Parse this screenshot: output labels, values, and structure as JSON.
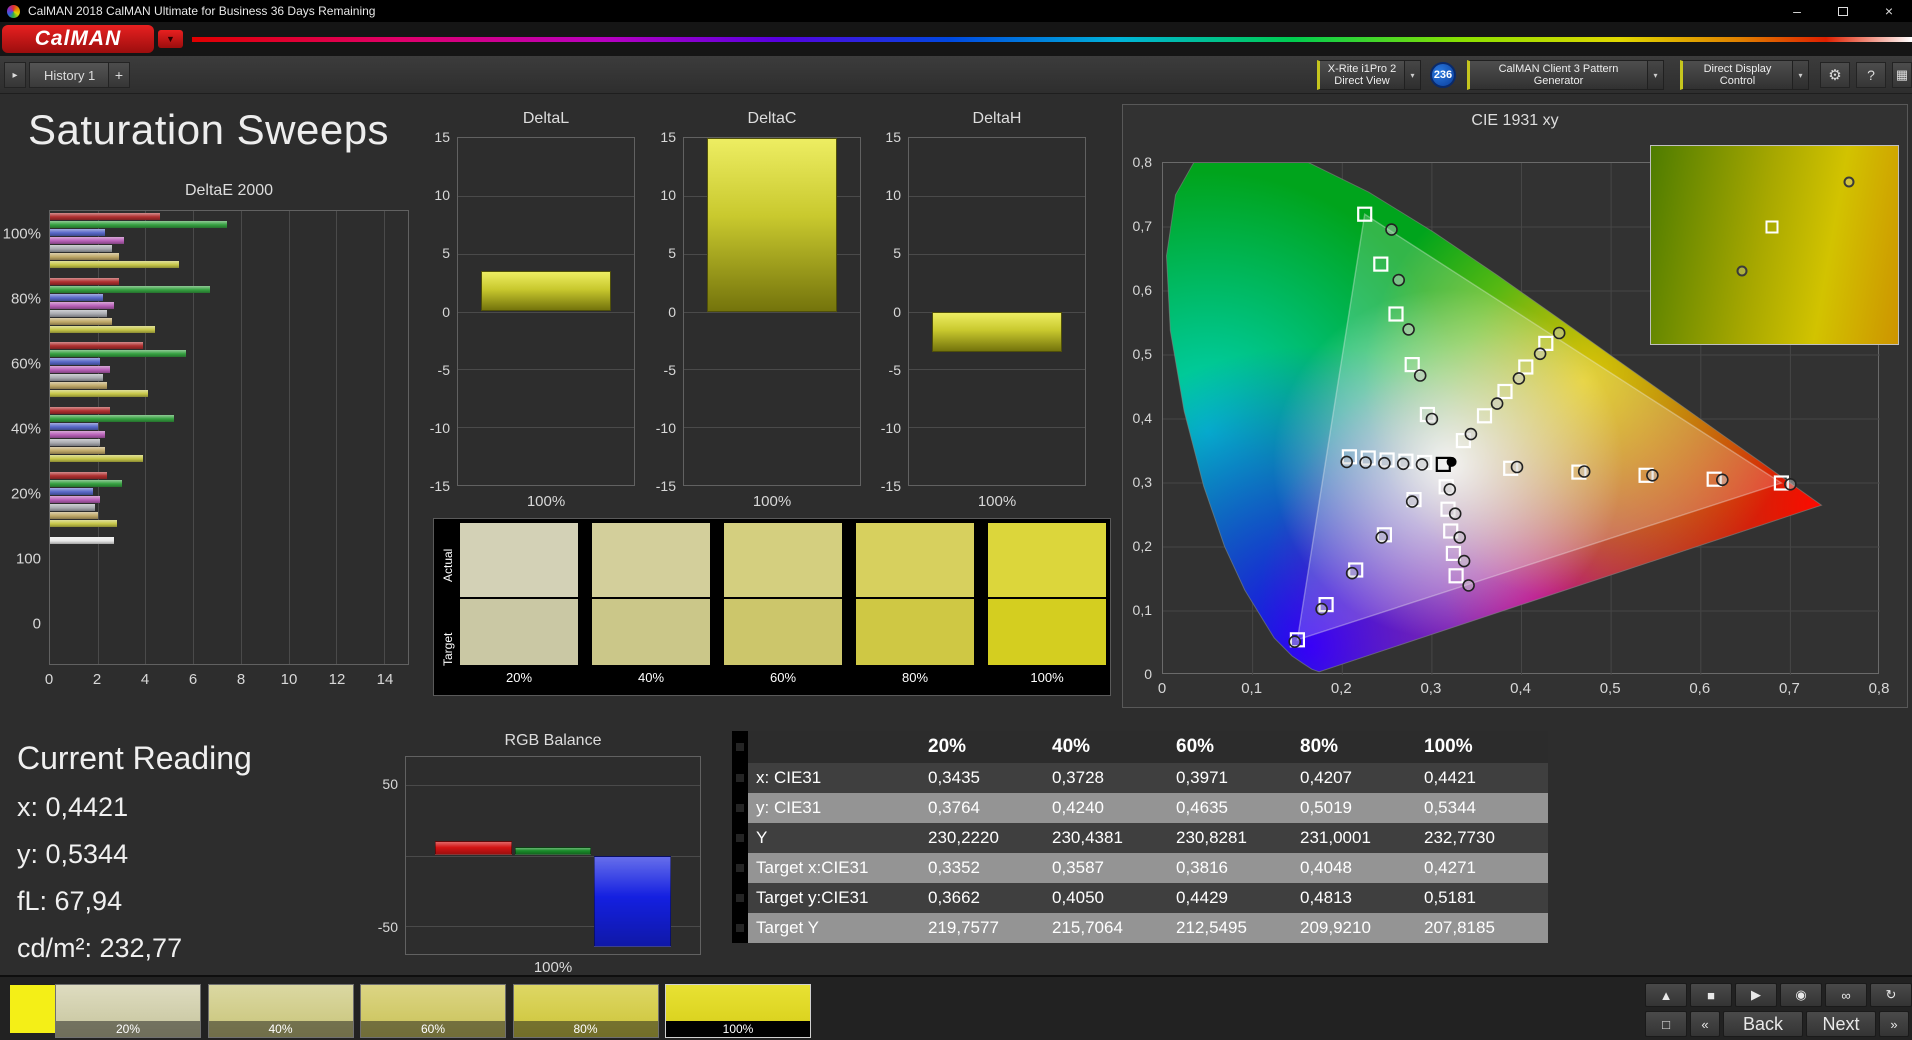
{
  "titlebar": {
    "title": "CalMAN 2018 CalMAN Ultimate for Business 36 Days Remaining",
    "min_glyph": "–",
    "close_glyph": "×"
  },
  "brand": {
    "logo": "CalMAN",
    "dd_glyph": "▼"
  },
  "toolbar": {
    "scroll_glyph": "▸",
    "history_tab": "History 1",
    "add_tab": "+",
    "meter_line1": "X-Rite i1Pro 2",
    "meter_line2": "Direct View",
    "badge": "236",
    "pattern_generator": "CalMAN Client 3 Pattern Generator",
    "display_control": "Direct Display Control",
    "chevron_glyph": "▾",
    "gear_glyph": "⚙",
    "help_glyph": "?",
    "layout_glyph": "▦"
  },
  "page_title": "Saturation Sweeps",
  "current_reading": {
    "title": "Current Reading",
    "lines": [
      "x: 0,4421",
      "y: 0,5344",
      "fL: 67,94",
      "cd/m²: 232,77"
    ]
  },
  "swatch_panel": {
    "row_labels": [
      "Actual",
      "Target"
    ],
    "columns": [
      {
        "label": "20%",
        "actual": "#d3d1b6",
        "target": "#cac8a4"
      },
      {
        "label": "40%",
        "actual": "#d3cf9b",
        "target": "#cbc789"
      },
      {
        "label": "60%",
        "actual": "#d4cf7f",
        "target": "#ccc66b"
      },
      {
        "label": "80%",
        "actual": "#d7d05e",
        "target": "#cfc844"
      },
      {
        "label": "100%",
        "actual": "#dcd63b",
        "target": "#d4ce20"
      }
    ]
  },
  "table": {
    "headers": [
      "",
      "20%",
      "40%",
      "60%",
      "80%",
      "100%"
    ],
    "rows": [
      {
        "label": "x: CIE31",
        "values": [
          "0,3435",
          "0,3728",
          "0,3971",
          "0,4207",
          "0,4421"
        ]
      },
      {
        "label": "y: CIE31",
        "values": [
          "0,3764",
          "0,4240",
          "0,4635",
          "0,5019",
          "0,5344"
        ]
      },
      {
        "label": "Y",
        "values": [
          "230,2220",
          "230,4381",
          "230,8281",
          "231,0001",
          "232,7730"
        ]
      },
      {
        "label": "Target x:CIE31",
        "values": [
          "0,3352",
          "0,3587",
          "0,3816",
          "0,4048",
          "0,4271"
        ]
      },
      {
        "label": "Target y:CIE31",
        "values": [
          "0,3662",
          "0,4050",
          "0,4429",
          "0,4813",
          "0,5181"
        ]
      },
      {
        "label": "Target Y",
        "values": [
          "219,7577",
          "215,7064",
          "212,5495",
          "209,9210",
          "207,8185"
        ]
      }
    ]
  },
  "bottombar": {
    "swatches": [
      {
        "label": "20%",
        "top": "#dedcc0",
        "bottom": "#c6c49c",
        "selected": false
      },
      {
        "label": "40%",
        "top": "#dbd8a2",
        "bottom": "#c8c478",
        "selected": false
      },
      {
        "label": "60%",
        "top": "#dcd584",
        "bottom": "#c9c257",
        "selected": false
      },
      {
        "label": "80%",
        "top": "#ded764",
        "bottom": "#ccc438",
        "selected": false
      },
      {
        "label": "100%",
        "top": "#e8e133",
        "bottom": "#d6ce18",
        "selected": true
      }
    ],
    "transport": [
      {
        "name": "eject-icon",
        "glyph": "▲"
      },
      {
        "name": "stop-icon",
        "glyph": "■"
      },
      {
        "name": "play-icon",
        "glyph": "▶"
      },
      {
        "name": "camera-icon",
        "glyph": "◉"
      },
      {
        "name": "infinity-icon",
        "glyph": "∞"
      },
      {
        "name": "loop-icon",
        "glyph": "↻"
      }
    ],
    "nav": {
      "pattern_glyph": "□",
      "prev_glyph": "«",
      "back": "Back",
      "next": "Next",
      "fwd_glyph": "»"
    }
  },
  "chart_data": [
    {
      "id": "deltae2000",
      "type": "bar",
      "orientation": "horizontal",
      "title": "DeltaE 2000",
      "xlim": [
        0,
        15
      ],
      "xticks": [
        0,
        2,
        4,
        6,
        8,
        10,
        12,
        14
      ],
      "groups": [
        {
          "label": "100%",
          "bars": [
            {
              "color": "#b03030",
              "value": 4.6
            },
            {
              "color": "#35a040",
              "value": 7.4
            },
            {
              "color": "#5868c8",
              "value": 2.3
            },
            {
              "color": "#b860b8",
              "value": 3.1
            },
            {
              "color": "#a8aab0",
              "value": 2.6
            },
            {
              "color": "#c0a868",
              "value": 2.9
            },
            {
              "color": "#c6c648",
              "value": 5.4
            }
          ]
        },
        {
          "label": "80%",
          "bars": [
            {
              "color": "#b03030",
              "value": 2.9
            },
            {
              "color": "#35a040",
              "value": 6.7
            },
            {
              "color": "#5868c8",
              "value": 2.2
            },
            {
              "color": "#b860b8",
              "value": 2.7
            },
            {
              "color": "#a8aab0",
              "value": 2.4
            },
            {
              "color": "#c0a868",
              "value": 2.6
            },
            {
              "color": "#c6c648",
              "value": 4.4
            }
          ]
        },
        {
          "label": "60%",
          "bars": [
            {
              "color": "#b03030",
              "value": 3.9
            },
            {
              "color": "#35a040",
              "value": 5.7
            },
            {
              "color": "#5868c8",
              "value": 2.1
            },
            {
              "color": "#b860b8",
              "value": 2.5
            },
            {
              "color": "#a8aab0",
              "value": 2.2
            },
            {
              "color": "#c0a868",
              "value": 2.4
            },
            {
              "color": "#c6c648",
              "value": 4.1
            }
          ]
        },
        {
          "label": "40%",
          "bars": [
            {
              "color": "#b03030",
              "value": 2.5
            },
            {
              "color": "#35a040",
              "value": 5.2
            },
            {
              "color": "#5868c8",
              "value": 2.0
            },
            {
              "color": "#b860b8",
              "value": 2.3
            },
            {
              "color": "#a8aab0",
              "value": 2.1
            },
            {
              "color": "#c0a868",
              "value": 2.3
            },
            {
              "color": "#c6c648",
              "value": 3.9
            }
          ]
        },
        {
          "label": "20%",
          "bars": [
            {
              "color": "#b03030",
              "value": 2.4
            },
            {
              "color": "#35a040",
              "value": 3.0
            },
            {
              "color": "#5868c8",
              "value": 1.8
            },
            {
              "color": "#b860b8",
              "value": 2.1
            },
            {
              "color": "#a8aab0",
              "value": 1.9
            },
            {
              "color": "#c0a868",
              "value": 2.0
            },
            {
              "color": "#c6c648",
              "value": 2.8
            }
          ]
        },
        {
          "label": "100",
          "bars": [
            {
              "color": "#e8e8e8",
              "value": 2.7
            }
          ]
        },
        {
          "label": "0",
          "bars": []
        }
      ]
    },
    {
      "id": "deltaL",
      "type": "bar",
      "title": "DeltaL",
      "ylim": [
        -15,
        15
      ],
      "yticks": [
        15,
        10,
        5,
        0,
        -5,
        -10,
        -15
      ],
      "categories": [
        "100%"
      ],
      "values": [
        3.5
      ],
      "xlabel": "100%"
    },
    {
      "id": "deltaC",
      "type": "bar",
      "title": "DeltaC",
      "ylim": [
        -15,
        15
      ],
      "yticks": [
        15,
        10,
        5,
        0,
        -5,
        -10,
        -15
      ],
      "categories": [
        "100%"
      ],
      "values": [
        15
      ],
      "xlabel": "100%"
    },
    {
      "id": "deltaH",
      "type": "bar",
      "title": "DeltaH",
      "ylim": [
        -15,
        15
      ],
      "yticks": [
        15,
        10,
        5,
        0,
        -5,
        -10,
        -15
      ],
      "categories": [
        "100%"
      ],
      "values": [
        -3.5
      ],
      "xlabel": "100%"
    },
    {
      "id": "rgb-balance",
      "type": "bar",
      "title": "RGB Balance",
      "ylim": [
        -70,
        70
      ],
      "yticks": [
        50,
        -50
      ],
      "gridlines": [
        50,
        0,
        -50
      ],
      "xlabel": "100%",
      "series": [
        {
          "name": "Red",
          "color": "#d41414",
          "value": 10
        },
        {
          "name": "Green",
          "color": "#1a8c2a",
          "value": 6
        },
        {
          "name": "Blue",
          "color": "#1420e0",
          "value": -65
        }
      ]
    },
    {
      "id": "cie1931",
      "type": "scatter",
      "title": "CIE 1931 xy",
      "xlim": [
        0,
        0.8
      ],
      "ylim": [
        0,
        0.8
      ],
      "xticklabels": [
        "0",
        "0,1",
        "0,2",
        "0,3",
        "0,4",
        "0,5",
        "0,6",
        "0,7",
        "0,8"
      ],
      "yticklabels": [
        "0",
        "0,1",
        "0,2",
        "0,3",
        "0,4",
        "0,5",
        "0,6",
        "0,7",
        "0,8"
      ],
      "gamut_triangle": [
        [
          0.15,
          0.055
        ],
        [
          0.225,
          0.72
        ],
        [
          0.69,
          0.3
        ]
      ],
      "series": [
        {
          "name": "targets",
          "marker": "square",
          "color": "#ffffff",
          "points": [
            [
              0.388,
              0.323
            ],
            [
              0.464,
              0.317
            ],
            [
              0.539,
              0.312
            ],
            [
              0.615,
              0.306
            ],
            [
              0.69,
              0.3
            ],
            [
              0.295,
              0.407
            ],
            [
              0.278,
              0.485
            ],
            [
              0.26,
              0.564
            ],
            [
              0.243,
              0.642
            ],
            [
              0.225,
              0.72
            ],
            [
              0.28,
              0.274
            ],
            [
              0.247,
              0.219
            ],
            [
              0.215,
              0.164
            ],
            [
              0.182,
              0.11
            ],
            [
              0.15,
              0.055
            ],
            [
              0.292,
              0.332
            ],
            [
              0.271,
              0.334
            ],
            [
              0.25,
              0.336
            ],
            [
              0.229,
              0.339
            ],
            [
              0.208,
              0.341
            ],
            [
              0.316,
              0.294
            ],
            [
              0.318,
              0.259
            ],
            [
              0.321,
              0.225
            ],
            [
              0.324,
              0.19
            ],
            [
              0.327,
              0.155
            ],
            [
              0.3352,
              0.3662
            ],
            [
              0.3587,
              0.405
            ],
            [
              0.3816,
              0.4429
            ],
            [
              0.4048,
              0.4813
            ],
            [
              0.4271,
              0.5181
            ]
          ]
        },
        {
          "name": "measurements",
          "marker": "circle",
          "color": "#222222",
          "points": [
            [
              0.395,
              0.325
            ],
            [
              0.47,
              0.318
            ],
            [
              0.546,
              0.312
            ],
            [
              0.624,
              0.305
            ],
            [
              0.7,
              0.298
            ],
            [
              0.3,
              0.4
            ],
            [
              0.287,
              0.468
            ],
            [
              0.274,
              0.54
            ],
            [
              0.263,
              0.617
            ],
            [
              0.255,
              0.696
            ],
            [
              0.278,
              0.271
            ],
            [
              0.244,
              0.215
            ],
            [
              0.211,
              0.159
            ],
            [
              0.177,
              0.103
            ],
            [
              0.147,
              0.052
            ],
            [
              0.289,
              0.329
            ],
            [
              0.268,
              0.33
            ],
            [
              0.247,
              0.331
            ],
            [
              0.226,
              0.332
            ],
            [
              0.205,
              0.333
            ],
            [
              0.32,
              0.29
            ],
            [
              0.326,
              0.252
            ],
            [
              0.331,
              0.215
            ],
            [
              0.336,
              0.178
            ],
            [
              0.341,
              0.14
            ],
            [
              0.3435,
              0.3764
            ],
            [
              0.3728,
              0.424
            ],
            [
              0.3971,
              0.4635
            ],
            [
              0.4207,
              0.5019
            ],
            [
              0.4421,
              0.5344
            ]
          ]
        },
        {
          "name": "whitepoint-target",
          "marker": "square",
          "color": "#000000",
          "points": [
            [
              0.3127,
              0.329
            ]
          ]
        },
        {
          "name": "whitepoint-measured",
          "marker": "dot",
          "color": "#000000",
          "points": [
            [
              0.322,
              0.333
            ]
          ]
        }
      ],
      "inset": {
        "squares": [
          [
            0.49,
            0.41
          ]
        ],
        "circles": [
          [
            0.8,
            0.18
          ],
          [
            0.37,
            0.63
          ]
        ]
      }
    }
  ]
}
